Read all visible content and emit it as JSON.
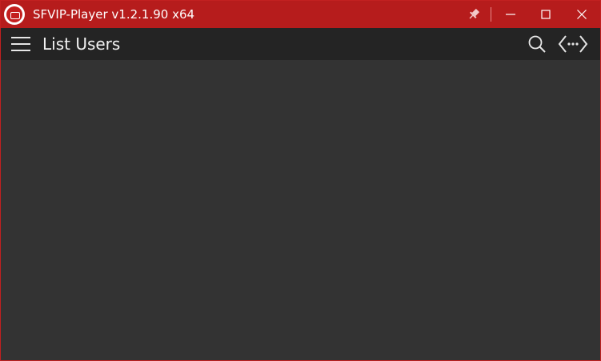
{
  "window": {
    "title": "SFVIP-Player v1.2.1.90 x64",
    "accent_color": "#b61c1c"
  },
  "titlebar": {
    "pin_icon": "pin-icon",
    "minimize_icon": "minimize-icon",
    "maximize_icon": "maximize-icon",
    "close_icon": "close-icon"
  },
  "toolbar": {
    "menu_icon": "hamburger-menu-icon",
    "title": "List Users",
    "search_icon": "search-icon",
    "connect_icon": "connection-icon"
  },
  "colors": {
    "toolbar_bg": "#242424",
    "content_bg": "#333333"
  }
}
